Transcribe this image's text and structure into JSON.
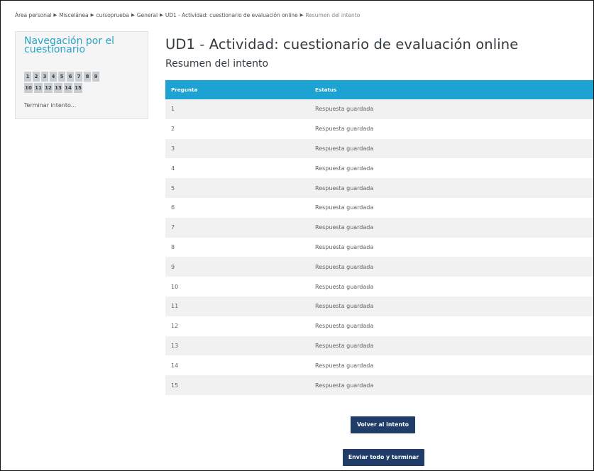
{
  "breadcrumb": [
    "Área personal",
    "Miscelánea",
    "cursoprueba",
    "General",
    "UD1 - Actividad: cuestionario de evaluación online",
    "Resumen del intento"
  ],
  "breadcrumb_separator": "▶",
  "nav": {
    "title": "Navegación por el cuestionario",
    "row1": [
      "1",
      "2",
      "3",
      "4",
      "5",
      "6",
      "7",
      "8",
      "9"
    ],
    "row2": [
      "10",
      "11",
      "12",
      "13",
      "14",
      "15"
    ],
    "finish_link": "Terminar intento..."
  },
  "main": {
    "title": "UD1 - Actividad: cuestionario de evaluación online",
    "subtitle": "Resumen del intento"
  },
  "table": {
    "headers": [
      "Pregunta",
      "Estatus"
    ],
    "rows": [
      [
        "1",
        "Respuesta guardada"
      ],
      [
        "2",
        "Respuesta guardada"
      ],
      [
        "3",
        "Respuesta guardada"
      ],
      [
        "4",
        "Respuesta guardada"
      ],
      [
        "5",
        "Respuesta guardada"
      ],
      [
        "6",
        "Respuesta guardada"
      ],
      [
        "7",
        "Respuesta guardada"
      ],
      [
        "8",
        "Respuesta guardada"
      ],
      [
        "9",
        "Respuesta guardada"
      ],
      [
        "10",
        "Respuesta guardada"
      ],
      [
        "11",
        "Respuesta guardada"
      ],
      [
        "12",
        "Respuesta guardada"
      ],
      [
        "13",
        "Respuesta guardada"
      ],
      [
        "14",
        "Respuesta guardada"
      ],
      [
        "15",
        "Respuesta guardada"
      ]
    ]
  },
  "buttons": {
    "return": "Volver al intento",
    "submit": "Enviar todo y terminar"
  },
  "colors": {
    "header_blue": "#1ca3d3",
    "button_navy": "#1f3d68",
    "nav_title": "#2aa3c9"
  }
}
